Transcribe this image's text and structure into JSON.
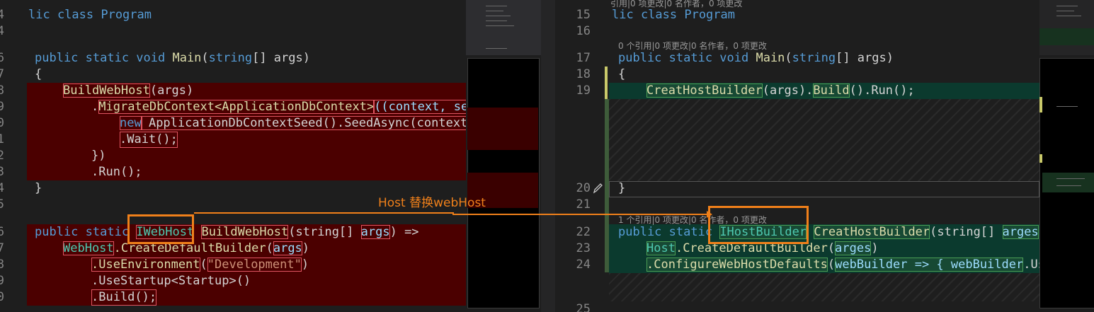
{
  "left": {
    "line_numbers": [
      "4",
      "",
      "6",
      "7",
      "8",
      "9",
      "0",
      "1",
      "2",
      "3",
      "4",
      "5",
      "",
      "6",
      "7",
      "8",
      "9",
      "0"
    ],
    "lines": {
      "l3": "lic class Program",
      "l6": "public static void Main(string[] args)",
      "l7": "{",
      "l8_fn": "BuildWebHost",
      "l8_rest": "(args)",
      "l9_a": ".",
      "l9_fn": "MigrateDbContext<ApplicationDbContext>",
      "l9_rest": "((context, ser",
      "l10_kw": "new",
      "l10_rest": " ApplicationDbContextSeed().SeedAsync(context,",
      "l11": ".Wait();",
      "l12": "})",
      "l13": ".Run();",
      "l14": "}",
      "l16_kw": "public static",
      "l16_ty": "IWebHost",
      "l16_fn": "BuildWebHost",
      "l16_rest1": "(string[] ",
      "l16_pm": "args",
      "l16_rest2": ") =>",
      "l17_ty": "WebHost",
      "l17_fn": ".CreateDefaultBuilder",
      "l17_pm": "args",
      "l18_fn": ".UseEnvironment",
      "l18_st": "\"Development\"",
      "l19": ".UseStartup<Startup>()",
      "l20": ".Build();"
    }
  },
  "right": {
    "line_numbers": [
      "15",
      "16",
      "17",
      "18",
      "19",
      "20",
      "21",
      "22",
      "23",
      "24",
      "25"
    ],
    "lens_top": "引用|0 项更改|0 名作者，0 项更改",
    "lens_main": "0 个引用|0 项更改|0 名作者，0 项更改",
    "lens_builder": "1 个引用|0 项更改|0 名作者，0 项更改",
    "l15": "lic class Program",
    "l17": "public static void Main(string[] args)",
    "l18": "{",
    "l19_fn": "CreatHostBuilder",
    "l19_a": "(args).",
    "l19_b": "Build",
    "l19_c": "().Run();",
    "l20": "}",
    "l22_kw": "public static",
    "l22_ty": "IHostBuilder",
    "l22_fn": "CreatHostBuilder",
    "l22_rest1": "(string[] ",
    "l22_pm": "arges",
    "l22_rest2": ")",
    "l23_ty": "Host",
    "l23_fn": ".CreateDefaultBuilder",
    "l23_pm": "arges",
    "l24_fn": ".ConfigureWebHostDefaults",
    "l24_pm": "webBuilder => { webBuilder",
    "l24_rest": ".Use"
  },
  "annotation": "Host 替换webHost",
  "colors": {
    "accent": "#f0801a",
    "deleted_bg": "#4b0000",
    "added_bg": "#0b3a2e"
  },
  "icons": {
    "codelens_edit": "pencil-icon"
  }
}
